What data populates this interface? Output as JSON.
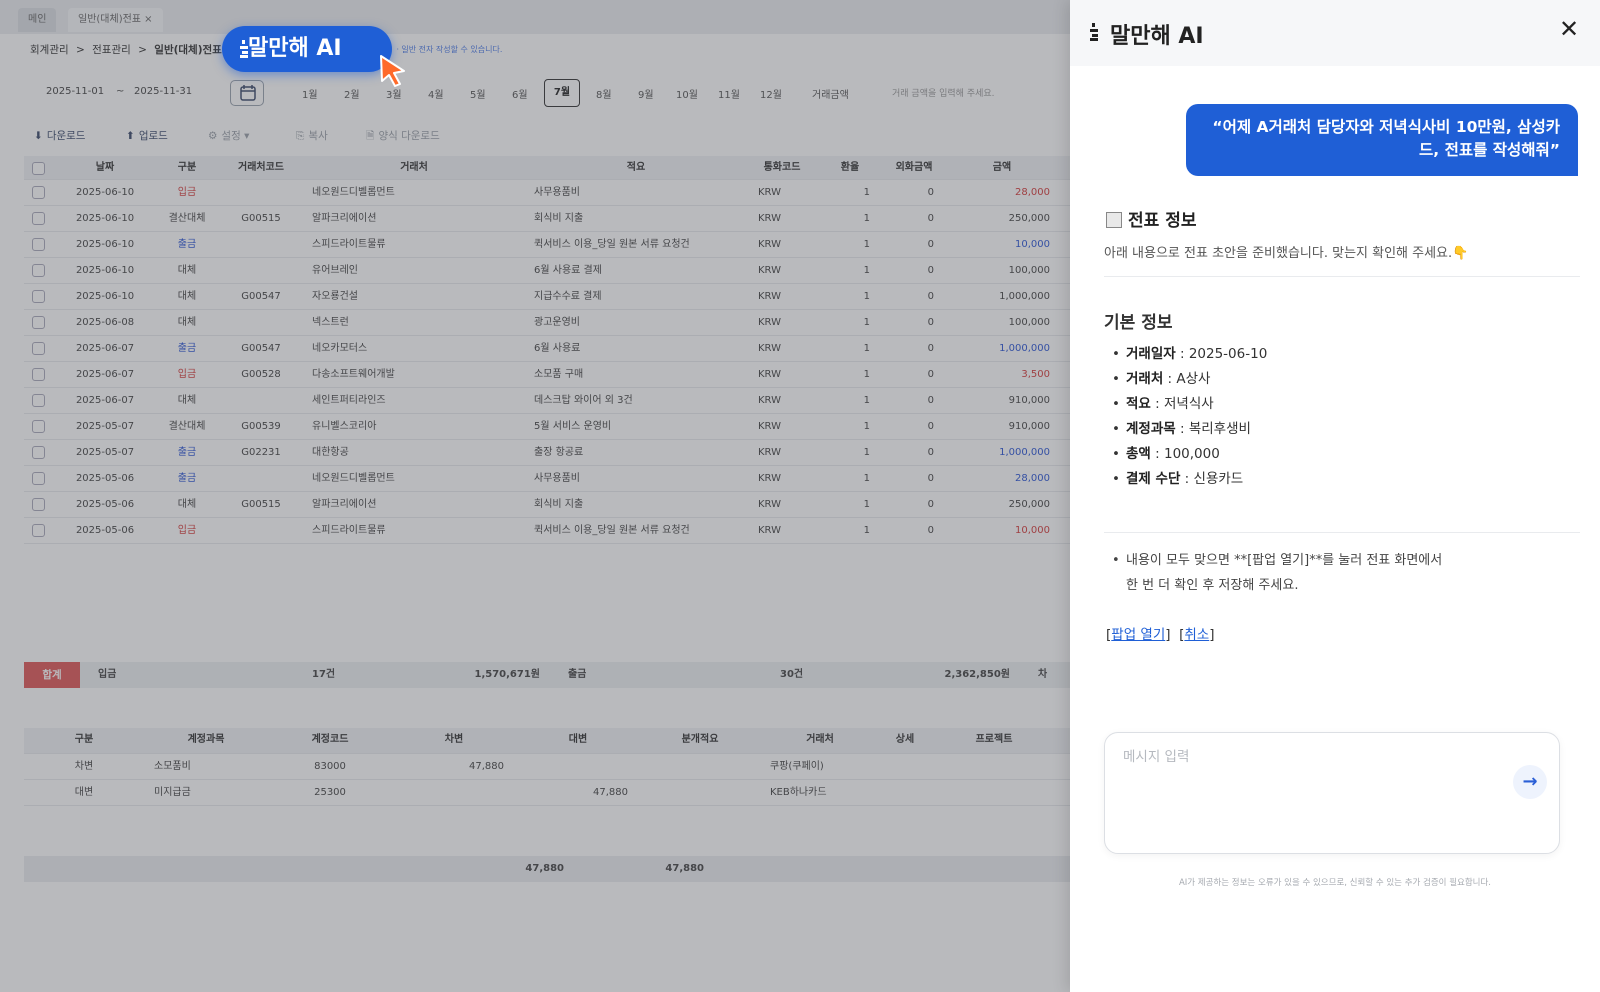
{
  "tabs": [
    "메인",
    "일반(대체)전표 ×"
  ],
  "breadcrumb": [
    "회계관리",
    ">",
    "전표관리",
    ">",
    "일반(대체)전표"
  ],
  "breadcrumb_note": "ㆍ일반 전자 작성할 수 있습니다.",
  "ai_badge_label": "말만해 AI",
  "filter": {
    "date_from": "2025-11-01",
    "date_sep": "~",
    "date_to": "2025-11-31",
    "months": [
      "1월",
      "2월",
      "3월",
      "4월",
      "5월",
      "6월",
      "7월",
      "8월",
      "9월",
      "10월",
      "11월",
      "12월"
    ],
    "selected_month": "7월",
    "amount_label": "거래금액",
    "amount_placeholder": "거래 금액을 입력해 주세요."
  },
  "toolbar": {
    "download": "다운로드",
    "upload": "업로드",
    "settings": "설정",
    "copy": "복사",
    "form_download": "양식 다운로드"
  },
  "grid": {
    "headers": [
      "날짜",
      "구분",
      "거래처코드",
      "거래처",
      "적요",
      "통화코드",
      "환율",
      "외화금액",
      "금액"
    ],
    "rows": [
      [
        "2025-06-10",
        "입금",
        "",
        "네오원드디벨롭먼트",
        "사무용품비",
        "KRW",
        "1",
        "0",
        "28,000"
      ],
      [
        "2025-06-10",
        "결산대체",
        "G00515",
        "알파크리에이션",
        "회식비 지출",
        "KRW",
        "1",
        "0",
        "250,000"
      ],
      [
        "2025-06-10",
        "출금",
        "",
        "스피드라이트물류",
        "퀵서비스 이용_당일 원본 서류 요청건",
        "KRW",
        "1",
        "0",
        "10,000"
      ],
      [
        "2025-06-10",
        "대체",
        "",
        "유어브레인",
        "6월 사용료 결제",
        "KRW",
        "1",
        "0",
        "100,000"
      ],
      [
        "2025-06-10",
        "대체",
        "G00547",
        "자오룡건설",
        "지급수수료 결제",
        "KRW",
        "1",
        "0",
        "1,000,000"
      ],
      [
        "2025-06-08",
        "대체",
        "",
        "넥스트런",
        "광고운영비",
        "KRW",
        "1",
        "0",
        "100,000"
      ],
      [
        "2025-06-07",
        "출금",
        "G00547",
        "네오카모터스",
        "6월 사용료",
        "KRW",
        "1",
        "0",
        "1,000,000"
      ],
      [
        "2025-06-07",
        "입금",
        "G00528",
        "다송소프트웨어개발",
        "소모품 구매",
        "KRW",
        "1",
        "0",
        "3,500"
      ],
      [
        "2025-06-07",
        "대체",
        "",
        "세인트퍼티라인즈",
        "데스크탑 와이어 외 3건",
        "KRW",
        "1",
        "0",
        "910,000"
      ],
      [
        "2025-05-07",
        "결산대체",
        "G00539",
        "유니벨스코리아",
        "5월 서비스 운영비",
        "KRW",
        "1",
        "0",
        "910,000"
      ],
      [
        "2025-05-07",
        "출금",
        "G02231",
        "대한항공",
        "출장 항공료",
        "KRW",
        "1",
        "0",
        "1,000,000"
      ],
      [
        "2025-05-06",
        "출금",
        "",
        "네오원드디벨롭먼트",
        "사무용품비",
        "KRW",
        "1",
        "0",
        "28,000"
      ],
      [
        "2025-05-06",
        "대체",
        "G00515",
        "알파크리에이션",
        "회식비 지출",
        "KRW",
        "1",
        "0",
        "250,000"
      ],
      [
        "2025-05-06",
        "입금",
        "",
        "스피드라이트물류",
        "퀵서비스 이용_당일 원본 서류 요청건",
        "KRW",
        "1",
        "0",
        "10,000"
      ]
    ]
  },
  "totals": {
    "label": "합계",
    "in_label": "입금",
    "in_count": "17건",
    "in_amount": "1,570,671원",
    "out_label": "출금",
    "out_count": "30건",
    "out_amount": "2,362,850원",
    "more": "차"
  },
  "subgrid": {
    "headers": [
      "구분",
      "계정과목",
      "계정코드",
      "차변",
      "대변",
      "분개적요",
      "거래처",
      "상세",
      "프로젝트"
    ],
    "rows": [
      [
        "차변",
        "소모품비",
        "83000",
        "47,880",
        "",
        "",
        "쿠팡(쿠페이)",
        "",
        ""
      ],
      [
        "대변",
        "미지급금",
        "25300",
        "",
        "47,880",
        "",
        "KEB하나카드",
        "",
        ""
      ]
    ],
    "sum_debit": "47,880",
    "sum_credit": "47,880"
  },
  "panel": {
    "title": "말만해 AI",
    "close_label": "✕",
    "user_message": "“어제 A거래처 담당자와 저녁식사비 10만원, 삼성카드, 전표를 작성해줘”",
    "section_title": "전표 정보",
    "section_desc": "아래 내용으로 전표 초안을 준비했습니다. 맞는지 확인해 주세요.👇",
    "basic_title": "기본 정보",
    "fields": [
      {
        "label": "거래일자",
        "value": "2025-06-10"
      },
      {
        "label": "거래처",
        "value": "A상사"
      },
      {
        "label": "적요",
        "value": "저녁식사"
      },
      {
        "label": "계정과목",
        "value": "복리후생비"
      },
      {
        "label": "총액",
        "value": "100,000"
      },
      {
        "label": "결제 수단",
        "value": "신용카드"
      }
    ],
    "note_line1": "내용이 모두 맞으면 **[팝업 열기]**를 눌러 전표 화면에서",
    "note_line2": "한 번 더 확인 후 저장해 주세요.",
    "link_open": "팝업 열기",
    "link_cancel": "취소",
    "input_placeholder": "메시지 입력",
    "send_label": "→",
    "disclaimer": "AI가 제공하는 정보는 오류가 있을 수 있으므로, 신뢰할 수 있는 추가 검증이 필요합니다."
  },
  "colors": {
    "accent": "#1f5fd6",
    "income": "#d63a3a",
    "expense": "#2b55d6",
    "total_badge": "#e15757"
  }
}
